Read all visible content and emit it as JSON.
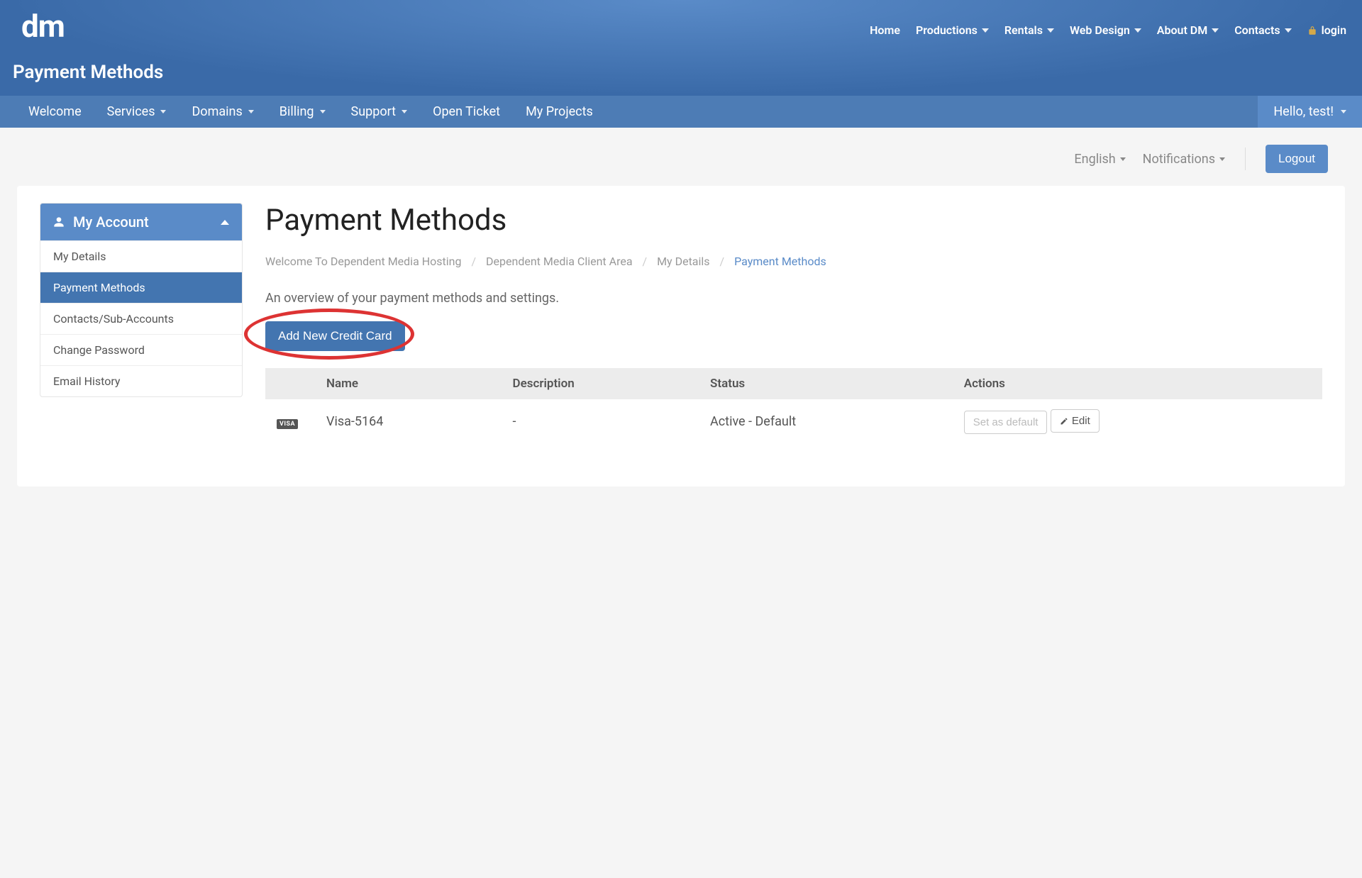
{
  "logo": "dm",
  "top_nav": {
    "home": "Home",
    "productions": "Productions",
    "rentals": "Rentals",
    "web_design": "Web Design",
    "about": "About DM",
    "contacts": "Contacts",
    "login": "login"
  },
  "page_title_top": "Payment Methods",
  "nav": {
    "welcome": "Welcome",
    "services": "Services",
    "domains": "Domains",
    "billing": "Billing",
    "support": "Support",
    "open_ticket": "Open Ticket",
    "my_projects": "My Projects",
    "hello": "Hello, test!"
  },
  "utility": {
    "language": "English",
    "notifications": "Notifications",
    "logout": "Logout"
  },
  "sidebar": {
    "header": "My Account",
    "items": [
      "My Details",
      "Payment Methods",
      "Contacts/Sub-Accounts",
      "Change Password",
      "Email History"
    ],
    "active_index": 1
  },
  "main": {
    "heading": "Payment Methods",
    "breadcrumb": [
      "Welcome To Dependent Media Hosting",
      "Dependent Media Client Area",
      "My Details",
      "Payment Methods"
    ],
    "overview": "An overview of your payment methods and settings.",
    "add_button": "Add New Credit Card",
    "table": {
      "headers": [
        "",
        "Name",
        "Description",
        "Status",
        "Actions"
      ],
      "row": {
        "card_type": "VISA",
        "name": "Visa-5164",
        "description": "-",
        "status": "Active - Default",
        "set_default": "Set as default",
        "edit": "Edit"
      }
    }
  }
}
